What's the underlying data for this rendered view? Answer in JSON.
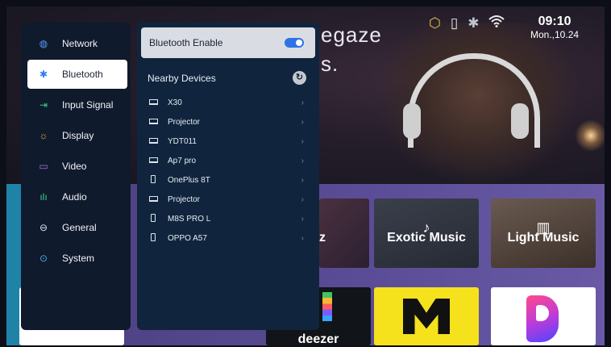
{
  "background": {
    "hero_title_line1": "egaze",
    "hero_title_line2": "s.",
    "status": {
      "settings_icon": "hexagon-gear-icon",
      "usb_icon": "usb-icon",
      "bluetooth_icon": "bluetooth-icon",
      "wifi_icon": "wifi-icon",
      "time": "09:10",
      "date": "Mon.,10.24"
    },
    "tiles": {
      "partial_label": "z",
      "exotic_music": "Exotic Music",
      "light_music": "Light Music",
      "deezer": "deezer"
    }
  },
  "settings_menu": {
    "items": [
      {
        "label": "Network",
        "icon": "globe-icon"
      },
      {
        "label": "Bluetooth",
        "icon": "bluetooth-icon",
        "selected": true
      },
      {
        "label": "Input Signal",
        "icon": "input-icon"
      },
      {
        "label": "Display",
        "icon": "sun-icon"
      },
      {
        "label": "Video",
        "icon": "video-icon"
      },
      {
        "label": "Audio",
        "icon": "audio-icon"
      },
      {
        "label": "General",
        "icon": "general-icon"
      },
      {
        "label": "System",
        "icon": "system-icon"
      }
    ]
  },
  "bluetooth_panel": {
    "enable_label": "Bluetooth Enable",
    "enabled": true,
    "nearby_label": "Nearby Devices",
    "devices": [
      {
        "name": "X30",
        "type": "laptop"
      },
      {
        "name": "Projector",
        "type": "laptop"
      },
      {
        "name": "YDT011",
        "type": "laptop"
      },
      {
        "name": "Ap7 pro",
        "type": "laptop"
      },
      {
        "name": "OnePlus 8T",
        "type": "phone"
      },
      {
        "name": "Projector",
        "type": "laptop"
      },
      {
        "name": "M8S PRO L",
        "type": "phone"
      },
      {
        "name": "OPPO A57",
        "type": "phone"
      }
    ]
  },
  "colors": {
    "accent": "#2f73e6",
    "panel_bg": "#10253d",
    "menu_bg": "#0f1a2c"
  }
}
